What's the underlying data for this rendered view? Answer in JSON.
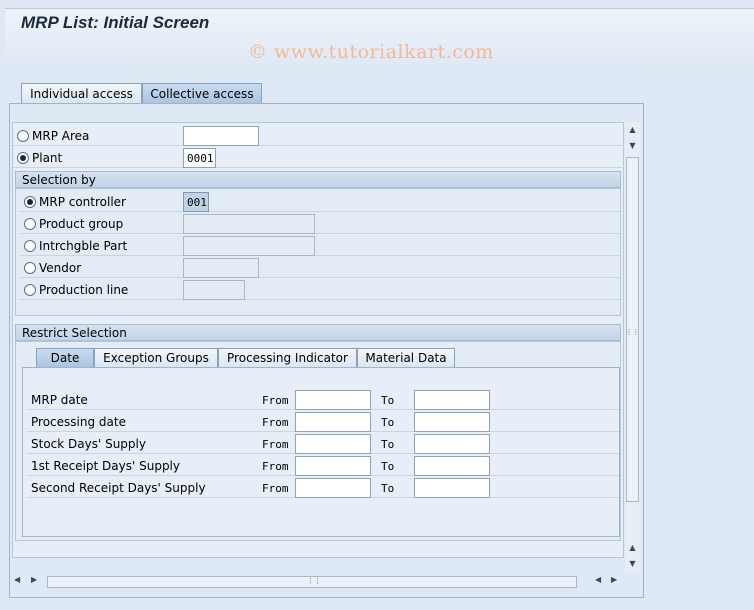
{
  "header": {
    "title": "MRP List: Initial Screen",
    "watermark": "© www.tutorialkart.com"
  },
  "outer_tabs": [
    {
      "label": "Individual access",
      "active": false
    },
    {
      "label": "Collective access",
      "active": true
    }
  ],
  "area": {
    "mrp_area": {
      "label": "MRP Area",
      "value": "",
      "selected": false
    },
    "plant": {
      "label": "Plant",
      "value": "0001",
      "selected": true
    }
  },
  "selection_by": {
    "header": "Selection by",
    "options": [
      {
        "label": "MRP controller",
        "value": "001",
        "selected": true
      },
      {
        "label": "Product group",
        "value": "",
        "selected": false
      },
      {
        "label": "Intrchgble Part",
        "value": "",
        "selected": false
      },
      {
        "label": "Vendor",
        "value": "",
        "selected": false
      },
      {
        "label": "Production line",
        "value": "",
        "selected": false
      }
    ]
  },
  "restrict": {
    "header": "Restrict Selection",
    "tabs": [
      {
        "label": "Date",
        "active": true
      },
      {
        "label": "Exception Groups",
        "active": false
      },
      {
        "label": "Processing Indicator",
        "active": false
      },
      {
        "label": "Material Data",
        "active": false
      }
    ],
    "from_label": "From",
    "to_label": "To",
    "rows": [
      {
        "label": "MRP date",
        "from": "",
        "to": ""
      },
      {
        "label": "Processing date",
        "from": "",
        "to": ""
      },
      {
        "label": "Stock Days' Supply",
        "from": "",
        "to": ""
      },
      {
        "label": "1st Receipt Days' Supply",
        "from": "",
        "to": ""
      },
      {
        "label": "Second Receipt Days' Supply",
        "from": "",
        "to": ""
      }
    ]
  },
  "icons": {
    "scroll_up": "▲",
    "scroll_down": "▼",
    "scroll_left": "◀",
    "scroll_right": "▶",
    "grip": "⋮⋮"
  }
}
